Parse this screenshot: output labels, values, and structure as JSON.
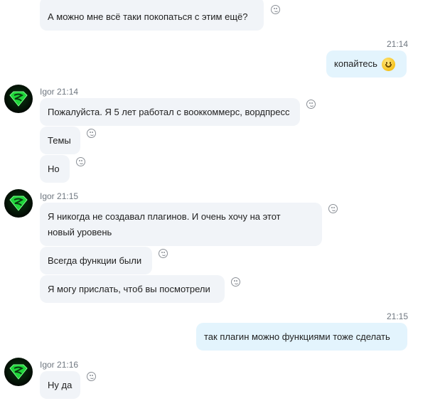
{
  "messages": [
    {
      "text": "А можно мне всё таки покопаться с этим ещё?"
    },
    {
      "time": "21:14",
      "text": "копайтесь",
      "emoji": "smiling-face-emoji"
    },
    {
      "sender": "Igor",
      "time": "21:14",
      "text": "Пожалуйста. Я 5 лет работал с вооккоммерс, вордпресс"
    },
    {
      "text": "Темы"
    },
    {
      "text": "Но"
    },
    {
      "sender": "Igor",
      "time": "21:15",
      "text": "Я никогда не создавал плагинов. И очень хочу на этот новый уровень"
    },
    {
      "text": "Всегда функции были"
    },
    {
      "text": "Я могу прислать, чтоб вы посмотрели"
    },
    {
      "time": "21:15",
      "text": "так плагин можно функциями тоже сделать"
    },
    {
      "sender": "Igor",
      "time": "21:16",
      "text": "Ну да"
    }
  ],
  "colors": {
    "incoming_bubble": "#f1f4f8",
    "outgoing_bubble": "#e3f4fd",
    "meta_text": "#6f7780"
  },
  "icons": {
    "reaction": "smiley-reaction-icon",
    "avatar": "green-superman-logo-avatar"
  }
}
